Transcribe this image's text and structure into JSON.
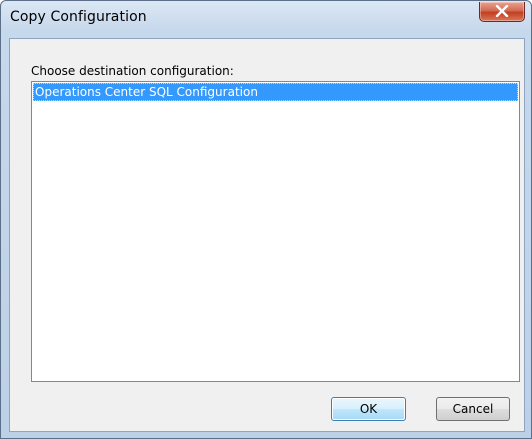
{
  "window": {
    "title": "Copy Configuration",
    "close_icon": "close-icon"
  },
  "dialog": {
    "prompt": "Choose destination configuration:",
    "items": [
      {
        "label": "Operations Center SQL Configuration",
        "selected": true
      }
    ]
  },
  "buttons": {
    "ok_label": "OK",
    "cancel_label": "Cancel"
  },
  "colors": {
    "selection": "#3399ff",
    "close_button": "#c1401f"
  }
}
